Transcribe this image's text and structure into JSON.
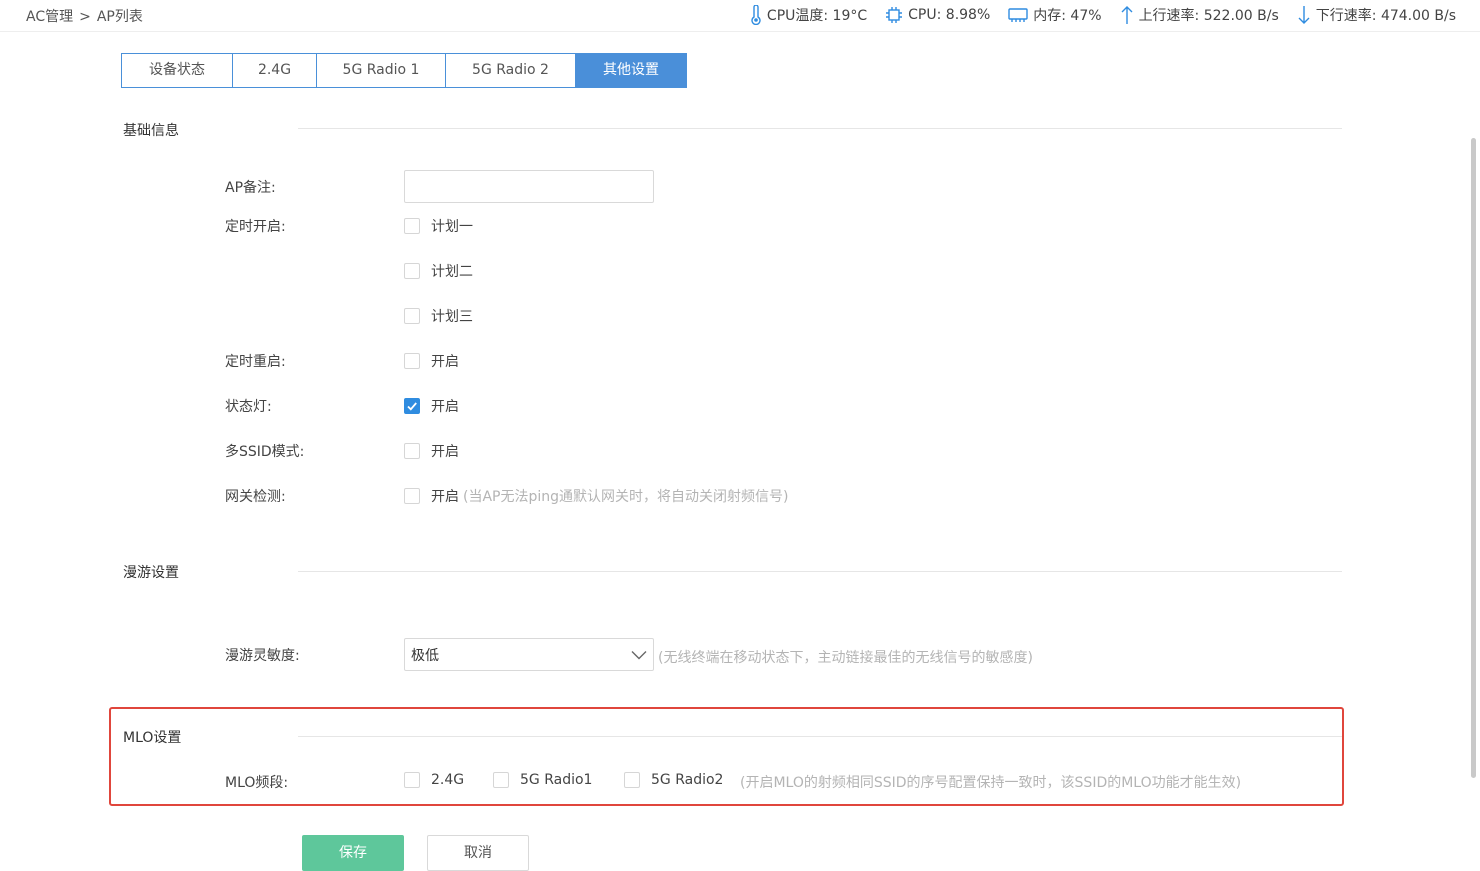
{
  "breadcrumb": {
    "root": "AC管理",
    "separator": ">",
    "current": "AP列表"
  },
  "stats": {
    "cpu_temp": "CPU温度: 19°C",
    "cpu": "CPU: 8.98%",
    "memory": "内存: 47%",
    "upload": "上行速率: 522.00 B/s",
    "download": "下行速率: 474.00 B/s"
  },
  "tabs": [
    {
      "label": "设备状态",
      "active": false
    },
    {
      "label": "2.4G",
      "active": false
    },
    {
      "label": "5G Radio 1",
      "active": false
    },
    {
      "label": "5G Radio 2",
      "active": false
    },
    {
      "label": "其他设置",
      "active": true
    }
  ],
  "basic": {
    "title": "基础信息",
    "ap_note": {
      "label": "AP备注:",
      "value": "",
      "placeholder": ""
    },
    "schedule_on": {
      "label": "定时开启:",
      "options": [
        {
          "label": "计划一",
          "checked": false
        },
        {
          "label": "计划二",
          "checked": false
        },
        {
          "label": "计划三",
          "checked": false
        }
      ]
    },
    "schedule_reboot": {
      "label": "定时重启:",
      "option": "开启",
      "checked": false
    },
    "status_led": {
      "label": "状态灯:",
      "option": "开启",
      "checked": true
    },
    "multi_ssid": {
      "label": "多SSID模式:",
      "option": "开启",
      "checked": false
    },
    "gateway_check": {
      "label": "网关检测:",
      "option": "开启",
      "checked": false,
      "hint": "(当AP无法ping通默认网关时，将自动关闭射频信号)"
    }
  },
  "roaming": {
    "title": "漫游设置",
    "sensitivity": {
      "label": "漫游灵敏度:",
      "value": "极低",
      "hint": "(无线终端在移动状态下，主动链接最佳的无线信号的敏感度)"
    }
  },
  "mlo": {
    "title": "MLO设置",
    "band": {
      "label": "MLO频段:",
      "options": [
        {
          "label": "2.4G",
          "checked": false
        },
        {
          "label": "5G Radio1",
          "checked": false
        },
        {
          "label": "5G Radio2",
          "checked": false
        }
      ],
      "hint": "(开启MLO的射频相同SSID的序号配置保持一致时，该SSID的MLO功能才能生效)"
    }
  },
  "buttons": {
    "save": "保存",
    "cancel": "取消"
  },
  "colors": {
    "accent": "#4a8fd9",
    "save": "#5ec79b",
    "highlight": "#e0463c",
    "checkbox_checked": "#2f8ce0"
  }
}
